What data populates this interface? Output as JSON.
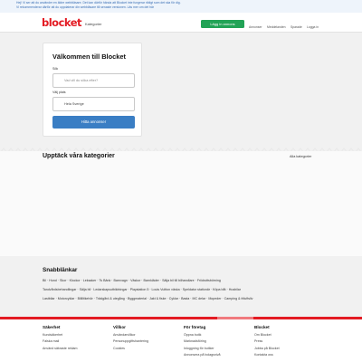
{
  "notice": {
    "line1": "Hej! Vi ser att du använder en äldre webbläsare. Det kan därför hända att Blocket inte fungerar riktigt som det ska för dig.",
    "line2": "Vi rekommenderar därför att du uppdaterar din webbläsare till senaste versionen. Läs mer om det här"
  },
  "header": {
    "logo": "blocket",
    "kategorier": "Kategorier",
    "ad_button": "Lägg in annons",
    "links": [
      "Annonser",
      "Meddelanden",
      "Sparade",
      "Logga in"
    ]
  },
  "welcome": {
    "title": "Välkommen till Blocket",
    "search_label": "Sök",
    "search_placeholder": "Vad vill du söka efter?",
    "place_label": "Välj plats",
    "place_value": "Hela Sverige",
    "search_button": "Hitta annonser"
  },
  "categories": {
    "title": "Upptäck våra kategorier",
    "all_link": "Alla kategorier"
  },
  "snabblankar": {
    "title": "Snabblänkar",
    "row1": [
      "Bil",
      "Hund",
      "Skor",
      "Klockor",
      "Leksaker",
      "Ts Bänk",
      "Barnvagn",
      "Väskor",
      "Barnkläder",
      "Sälja bil till bilhandlare",
      "Friidrottsbörning"
    ],
    "row2": [
      "Tandvårdsbehandlingar",
      "Sälja bil",
      "Ledarskapsutbildningar",
      "Playstation 5",
      "Louis Vuitton väska",
      "Speldator stationär",
      "Köpa båt",
      "Husbilar"
    ],
    "row3": [
      "Lastbilar",
      "Motorcyklar",
      "Billiltikehör",
      "Trädgård & utegång",
      "Byggmaterial",
      "Jakt & fiske",
      "Cyklar",
      "Basta",
      "MC delar",
      "Mopeder",
      "Camping & friluftsliv"
    ],
    "separator": "·"
  },
  "footer": {
    "columns": [
      {
        "title": "Säkerhet",
        "items": [
          "Kundsäkerhet",
          "Falska mail",
          "Använd säkraste reklam"
        ]
      },
      {
        "title": "Villkor",
        "items": [
          "Användarvillkor",
          "Personuppgiftshantering",
          "Cookies"
        ]
      },
      {
        "title": "För företag",
        "items": [
          "Öppna butik",
          "Marknadsföring",
          "Inloggning för butiker",
          "Annonsera på bolagsnivå"
        ]
      },
      {
        "title": "Blocket",
        "items": [
          "Om Blocket",
          "Press",
          "Jobba på Blocket",
          "Kontakta oss"
        ]
      }
    ]
  },
  "colors": {
    "brand_red": "#e31b23",
    "ad_green": "#22a356",
    "search_blue": "#3a7ec4",
    "notice_text": "#3a6fb5"
  }
}
